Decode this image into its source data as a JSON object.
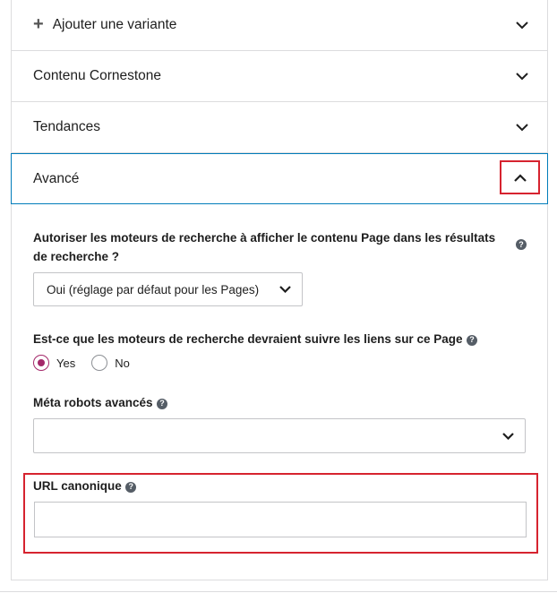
{
  "accordion": {
    "add_variant": {
      "label": "Ajouter une variante",
      "icon": "plus-icon"
    },
    "cornerstone": {
      "label": "Contenu Cornestone"
    },
    "trends": {
      "label": "Tendances"
    },
    "advanced": {
      "label": "Avancé",
      "expanded": true
    }
  },
  "advanced_panel": {
    "search_engines_show": {
      "label": "Autoriser les moteurs de recherche à afficher le contenu Page dans les résultats de recherche ?",
      "help_icon": "?",
      "selected": "Oui (réglage par défaut pour les Pages)"
    },
    "follow_links": {
      "label": "Est-ce que les moteurs de recherche devraient suivre les liens sur ce Page",
      "help_icon": "?",
      "options": [
        {
          "label": "Yes",
          "checked": true
        },
        {
          "label": "No",
          "checked": false
        }
      ]
    },
    "meta_robots": {
      "label": "Méta robots avancés",
      "help_icon": "?",
      "selected": ""
    },
    "canonical_url": {
      "label": "URL canonique",
      "help_icon": "?",
      "value": ""
    }
  },
  "colors": {
    "accent": "#007cba",
    "radio_checked": "#a4286a",
    "highlight": "#d6232f"
  }
}
